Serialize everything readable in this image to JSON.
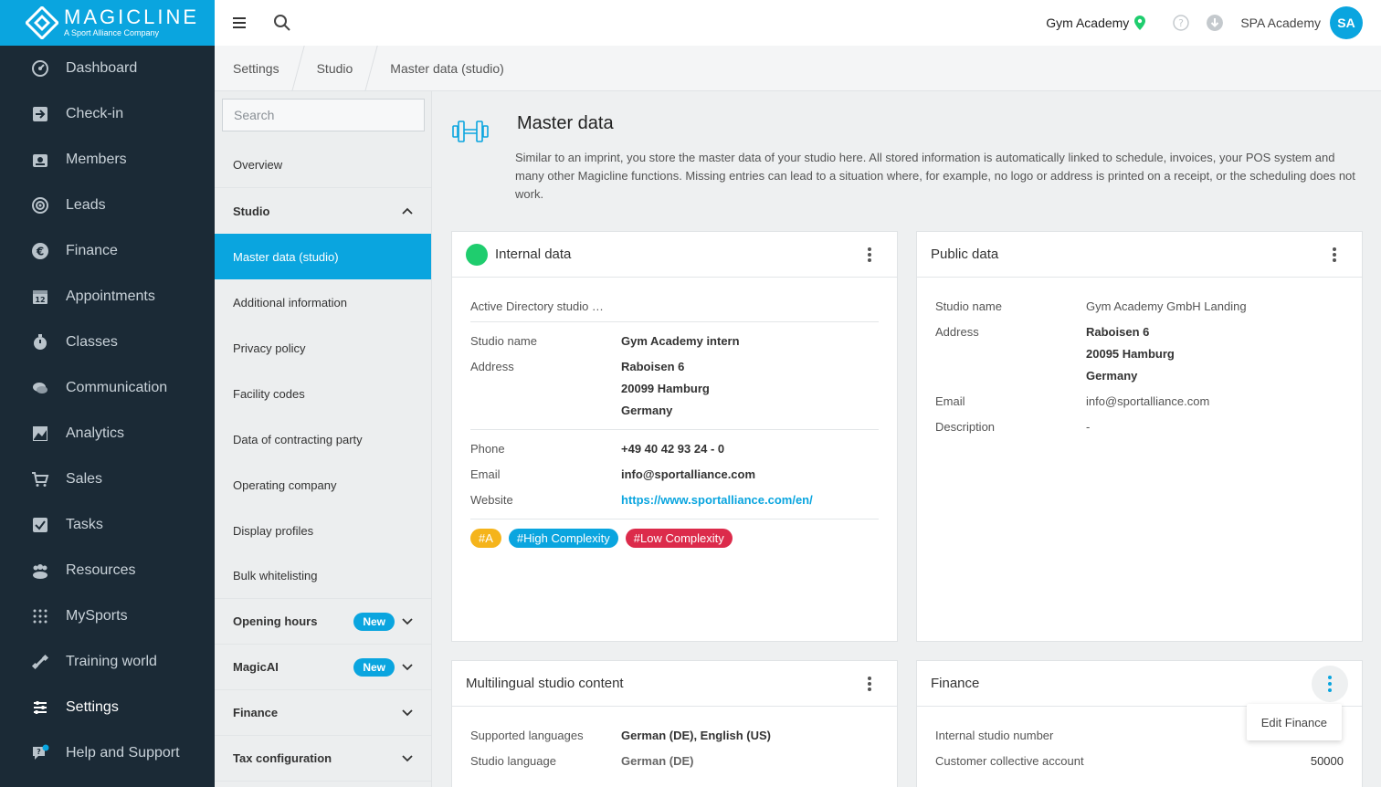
{
  "brand": {
    "name": "MAGICLINE",
    "tagline": "A Sport Alliance Company",
    "accent": "#0aa5df",
    "sidebar_bg": "#1b2a36"
  },
  "sidebar": {
    "items": [
      {
        "label": "Dashboard",
        "icon": "dashboard-icon"
      },
      {
        "label": "Check-in",
        "icon": "check-in-icon"
      },
      {
        "label": "Members",
        "icon": "members-icon"
      },
      {
        "label": "Leads",
        "icon": "leads-icon"
      },
      {
        "label": "Finance",
        "icon": "euro-icon"
      },
      {
        "label": "Appointments",
        "icon": "calendar-icon"
      },
      {
        "label": "Classes",
        "icon": "stopwatch-icon"
      },
      {
        "label": "Communication",
        "icon": "chat-icon"
      },
      {
        "label": "Analytics",
        "icon": "chart-icon"
      },
      {
        "label": "Sales",
        "icon": "cart-icon"
      },
      {
        "label": "Tasks",
        "icon": "checkbox-icon"
      },
      {
        "label": "Resources",
        "icon": "people-icon"
      },
      {
        "label": "MySports",
        "icon": "dots-grid-icon"
      },
      {
        "label": "Training world",
        "icon": "dumbbell-icon"
      },
      {
        "label": "Settings",
        "icon": "sliders-icon"
      },
      {
        "label": "Help and Support",
        "icon": "help-chat-icon"
      }
    ]
  },
  "topbar": {
    "studio": "Gym Academy",
    "account": "SPA Academy",
    "avatar_initials": "SA"
  },
  "breadcrumb": [
    "Settings",
    "Studio",
    "Master data (studio)"
  ],
  "subnav": {
    "search_placeholder": "Search",
    "overview": "Overview",
    "studio_head": "Studio",
    "studio_items": [
      "Master data (studio)",
      "Additional information",
      "Privacy policy",
      "Facility codes",
      "Data of contracting party",
      "Operating company",
      "Display profiles",
      "Bulk whitelisting"
    ],
    "opening_hours": "Opening hours",
    "magicai": "MagicAI",
    "new_badge": "New",
    "finance": "Finance",
    "tax": "Tax configuration"
  },
  "page": {
    "title": "Master data",
    "description": "Similar to an imprint, you store the master data of your studio here. All stored information is automatically linked to schedule, invoices, your POS system and many other Magicline functions. Missing entries can lead to a situation where, for example, no logo or address is printed on a receipt, or the scheduling does not work."
  },
  "internal": {
    "title": "Internal data",
    "status_color": "#1fcd6e",
    "ad_label": "Active Directory studio …",
    "studio_name_label": "Studio name",
    "studio_name": "Gym Academy intern",
    "address_label": "Address",
    "address": [
      "Raboisen 6",
      "20099 Hamburg",
      "Germany"
    ],
    "phone_label": "Phone",
    "phone": "+49 40 42 93 24 - 0",
    "email_label": "Email",
    "email": "info@sportalliance.com",
    "website_label": "Website",
    "website": "https://www.sportalliance.com/en/",
    "tags": [
      {
        "label": "#A",
        "color": "#f5b41b"
      },
      {
        "label": "#High Complexity",
        "color": "#0aa5df"
      },
      {
        "label": "#Low Complexity",
        "color": "#dc2b4b"
      }
    ]
  },
  "public": {
    "title": "Public data",
    "studio_name_label": "Studio name",
    "studio_name": "Gym Academy GmbH Landing",
    "address_label": "Address",
    "address": [
      "Raboisen 6",
      "20095 Hamburg",
      "Germany"
    ],
    "email_label": "Email",
    "email": "info@sportalliance.com",
    "description_label": "Description",
    "description": "-"
  },
  "multilingual": {
    "title": "Multilingual studio content",
    "supported_label": "Supported languages",
    "supported": "German (DE), English (US)",
    "language_label": "Studio language",
    "language": "German (DE)"
  },
  "finance": {
    "title": "Finance",
    "menu_item": "Edit Finance",
    "internal_number_label": "Internal studio number",
    "collective_label": "Customer collective account",
    "collective": "50000"
  }
}
